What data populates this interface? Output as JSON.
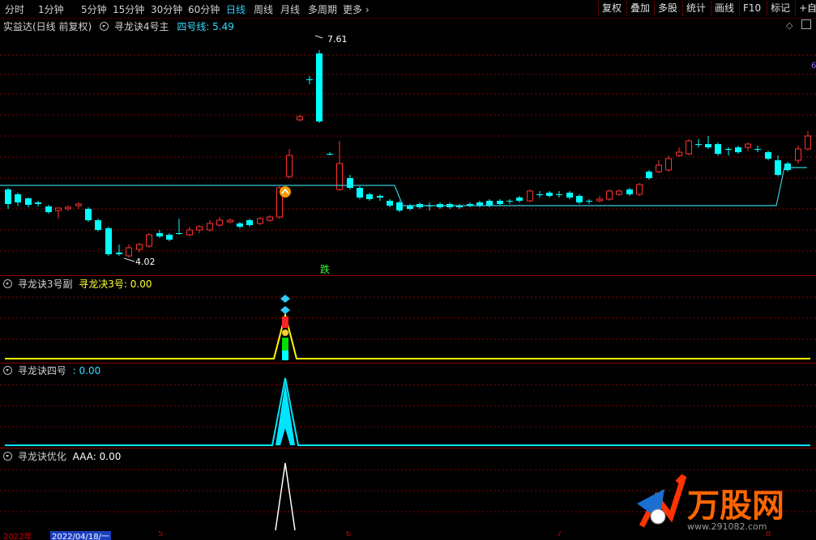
{
  "toolbar": {
    "periods": [
      "分时",
      "1分钟",
      "5分钟",
      "15分钟",
      "30分钟",
      "60分钟",
      "日线",
      "周线",
      "月线",
      "多周期",
      "更多"
    ],
    "active_period": "日线",
    "right_buttons": [
      "复权",
      "叠加",
      "多股",
      "统计",
      "画线",
      "F10",
      "标记",
      "+自选"
    ]
  },
  "main_panel": {
    "stock_title": "实益达(日线 前复权)",
    "indicator_name": "寻龙诀4号主",
    "indicator_value": "四号线: 5.49",
    "high_label": "7.61",
    "low_label": "4.02",
    "signal_text": "跌",
    "right_marker": "6"
  },
  "panel2": {
    "title": "寻龙诀3号副",
    "value": "寻龙决3号: 0.00"
  },
  "panel3": {
    "title": "寻龙诀四号",
    "value": ": 0.00"
  },
  "panel4": {
    "title": "寻龙诀优化",
    "value": "AAA: 0.00"
  },
  "bottom": {
    "year_label": "2022年",
    "date_label": "2022/04/18/一",
    "month_ticks": [
      "5",
      "6",
      "7",
      "8"
    ]
  },
  "watermark": {
    "brand": "万股网",
    "url": "www.291082.com"
  },
  "colors": {
    "up": "#ff3232",
    "down": "#00ffff",
    "line4": "#33ccdd",
    "line3": "#ffff00",
    "grid": "#8b0000"
  }
}
